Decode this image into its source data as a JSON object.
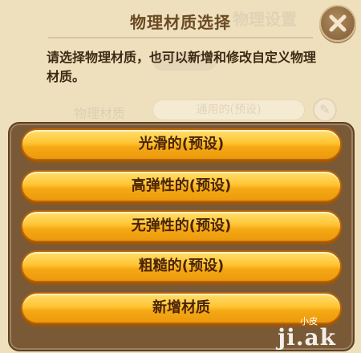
{
  "background_dialog": {
    "title": "物理设置",
    "row_label": "物理材质",
    "row_value": "通用的(预设)"
  },
  "dialog": {
    "title": "物理材质选择",
    "instruction": "请选择物理材质，也可以新增和修改自定义物理材质。",
    "close_icon": "close-x-icon"
  },
  "options": [
    {
      "label": "光滑的(预设)"
    },
    {
      "label": "高弹性的(预设)"
    },
    {
      "label": "无弹性的(预设)"
    },
    {
      "label": "粗糙的(预设)"
    },
    {
      "label": "新增材质"
    }
  ],
  "watermark": {
    "small": "小皮",
    "big": "ji.ak"
  },
  "colors": {
    "button_gold": "#ffc433",
    "button_border": "#b8650a",
    "panel_brown": "#7a5a36",
    "parchment": "#efe0bd",
    "title_brown": "#6b4a24"
  }
}
